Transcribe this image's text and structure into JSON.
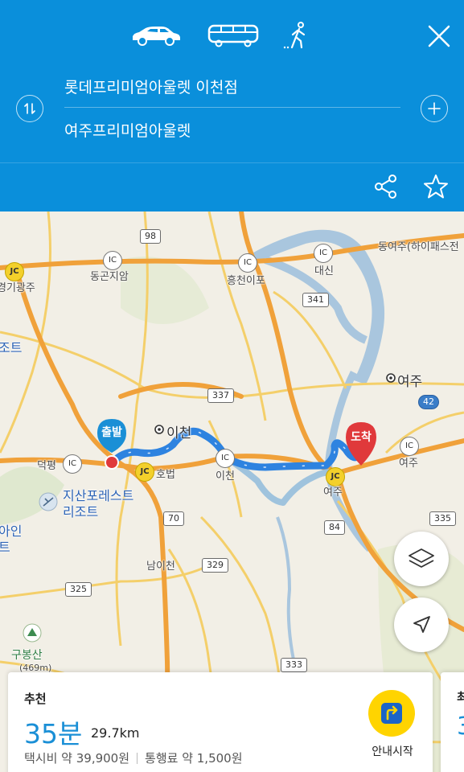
{
  "header": {
    "modes": [
      {
        "name": "car",
        "icon": "car-icon",
        "selected": true
      },
      {
        "name": "bus",
        "icon": "bus-icon",
        "selected": false
      },
      {
        "name": "walk",
        "icon": "walk-icon",
        "selected": false
      }
    ],
    "origin": "롯데프리미엄아울렛 이천점",
    "destination": "여주프리미엄아울렛",
    "accent_color": "#0a8fdb"
  },
  "map": {
    "places": {
      "gyeonggi_gwangju": "경기광주",
      "donggonjiam": "동곤지암",
      "heungcheon_ipo": "흥천이포",
      "daesin": "대신",
      "yeoju_hipass": "동여주(하이패스전",
      "yeoju_city": "여주",
      "icheon_city": "이천",
      "deokpyeong": "덕평",
      "hobeop": "호법",
      "icheon_ic": "이천",
      "yeoju_jc": "여주",
      "yeoju_ic": "여주",
      "jisan_resort_1": "지산포레스트",
      "jisan_resort_2": "리조트",
      "nam_icheon": "남이천",
      "gubongsan": "구봉산",
      "gubongsan_height": "(469m)",
      "edge_jo": "조트",
      "edge_ain": "아인",
      "edge_t": "트"
    },
    "road_numbers": {
      "r98": "98",
      "r341": "341",
      "r337": "337",
      "r42": "42",
      "r70": "70",
      "r84": "84",
      "r329": "329",
      "r325": "325",
      "r333": "333",
      "r335": "335"
    },
    "ic_label": "IC",
    "jc_label": "JC",
    "start_pin": "출발",
    "end_pin": "도착",
    "route_color": "#2e83e0",
    "start_color": "#1a8fd6",
    "end_color": "#e0393b"
  },
  "card": {
    "title": "추천",
    "time": "35분",
    "distance": "29.7km",
    "taxi_fare": "택시비 약 39,900원",
    "toll": "통행료 약 1,500원",
    "start_nav": "안내시작",
    "next_card_title": "최",
    "next_card_time": "3"
  }
}
